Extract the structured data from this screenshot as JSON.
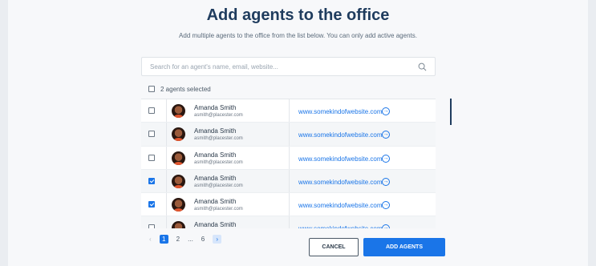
{
  "modal": {
    "title": "Add agents to the office",
    "subtitle": "Add multiple agents to the office from the list below. You can only add active agents."
  },
  "search": {
    "placeholder": "Search for an agent's name, email, website..."
  },
  "selection": {
    "label": "2 agents selected",
    "all_checked": false
  },
  "agents": [
    {
      "name": "Amanda Smith",
      "email": "asmith@placester.com",
      "website": "www.somekindofwebsite.com",
      "checked": false
    },
    {
      "name": "Amanda Smith",
      "email": "asmith@placester.com",
      "website": "www.somekindofwebsite.com",
      "checked": false
    },
    {
      "name": "Amanda Smith",
      "email": "asmith@placester.com",
      "website": "www.somekindofwebsite.com",
      "checked": false
    },
    {
      "name": "Amanda Smith",
      "email": "asmith@placester.com",
      "website": "www.somekindofwebsite.com",
      "checked": true
    },
    {
      "name": "Amanda Smith",
      "email": "asmith@placester.com",
      "website": "www.somekindofwebsite.com",
      "checked": true
    },
    {
      "name": "Amanda Smith",
      "email": "asmith@placester.com",
      "website": "www.somekindofwebsite.com",
      "checked": false
    }
  ],
  "pagination": {
    "prev": "‹",
    "pages": [
      "1",
      "2",
      "...",
      "6"
    ],
    "current": "1",
    "next": "›"
  },
  "buttons": {
    "cancel": "CANCEL",
    "add": "ADD AGENTS"
  },
  "colors": {
    "accent": "#1a75e8",
    "title": "#1f3c5e"
  }
}
